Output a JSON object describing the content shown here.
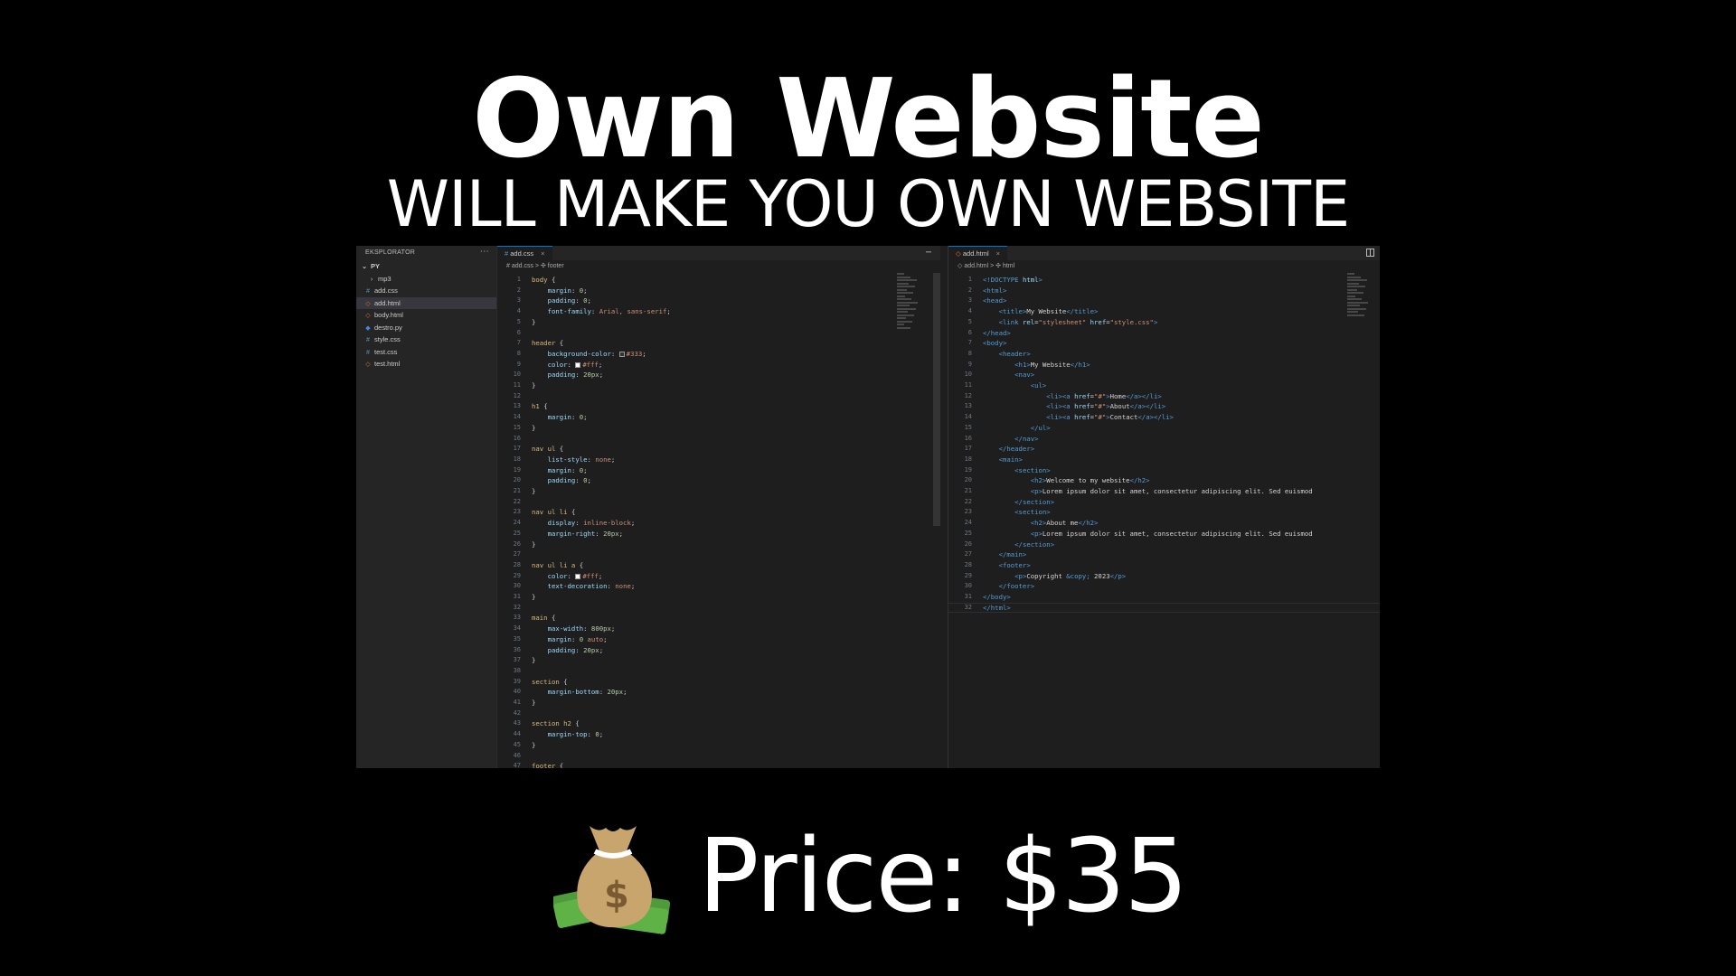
{
  "headline": "Own Website",
  "subline": "WILL MAKE YOU OWN WEBSITE",
  "price_label": "Price: $35",
  "editor": {
    "explorer_title": "EKSPLORATOR",
    "folder": "PY",
    "files": [
      {
        "name": "mp3",
        "kind": "folder"
      },
      {
        "name": "add.css",
        "kind": "css"
      },
      {
        "name": "add.html",
        "kind": "html",
        "active": true
      },
      {
        "name": "body.html",
        "kind": "html"
      },
      {
        "name": "destro.py",
        "kind": "py"
      },
      {
        "name": "style.css",
        "kind": "css"
      },
      {
        "name": "test.css",
        "kind": "css"
      },
      {
        "name": "test.html",
        "kind": "html"
      }
    ],
    "left_tab": "add.css",
    "left_crumb": "# add.css > ✣ footer",
    "right_tab": "add.html",
    "right_crumb": "◇ add.html > ✣ html",
    "css_lines": [
      [
        [
          "sel",
          "body "
        ],
        [
          "txt",
          "{"
        ]
      ],
      [
        [
          "prop",
          "    margin"
        ],
        [
          "txt",
          ": "
        ],
        [
          "num",
          "0"
        ],
        [
          "txt",
          ";"
        ]
      ],
      [
        [
          "prop",
          "    padding"
        ],
        [
          "txt",
          ": "
        ],
        [
          "num",
          "0"
        ],
        [
          "txt",
          ";"
        ]
      ],
      [
        [
          "prop",
          "    font-family"
        ],
        [
          "txt",
          ": "
        ],
        [
          "val",
          "Arial, sans-serif"
        ],
        [
          "txt",
          ";"
        ]
      ],
      [
        [
          "txt",
          "}"
        ]
      ],
      [],
      [
        [
          "sel",
          "header "
        ],
        [
          "txt",
          "{"
        ]
      ],
      [
        [
          "prop",
          "    background-color"
        ],
        [
          "txt",
          ": "
        ],
        [
          "sw",
          "#333"
        ],
        [
          "val",
          "#333"
        ],
        [
          "txt",
          ";"
        ]
      ],
      [
        [
          "prop",
          "    color"
        ],
        [
          "txt",
          ": "
        ],
        [
          "sw",
          "#fff"
        ],
        [
          "val",
          "#fff"
        ],
        [
          "txt",
          ";"
        ]
      ],
      [
        [
          "prop",
          "    padding"
        ],
        [
          "txt",
          ": "
        ],
        [
          "num",
          "20px"
        ],
        [
          "txt",
          ";"
        ]
      ],
      [
        [
          "txt",
          "}"
        ]
      ],
      [],
      [
        [
          "sel",
          "h1 "
        ],
        [
          "txt",
          "{"
        ]
      ],
      [
        [
          "prop",
          "    margin"
        ],
        [
          "txt",
          ": "
        ],
        [
          "num",
          "0"
        ],
        [
          "txt",
          ";"
        ]
      ],
      [
        [
          "txt",
          "}"
        ]
      ],
      [],
      [
        [
          "sel",
          "nav ul "
        ],
        [
          "txt",
          "{"
        ]
      ],
      [
        [
          "prop",
          "    list-style"
        ],
        [
          "txt",
          ": "
        ],
        [
          "val",
          "none"
        ],
        [
          "txt",
          ";"
        ]
      ],
      [
        [
          "prop",
          "    margin"
        ],
        [
          "txt",
          ": "
        ],
        [
          "num",
          "0"
        ],
        [
          "txt",
          ";"
        ]
      ],
      [
        [
          "prop",
          "    padding"
        ],
        [
          "txt",
          ": "
        ],
        [
          "num",
          "0"
        ],
        [
          "txt",
          ";"
        ]
      ],
      [
        [
          "txt",
          "}"
        ]
      ],
      [],
      [
        [
          "sel",
          "nav ul li "
        ],
        [
          "txt",
          "{"
        ]
      ],
      [
        [
          "prop",
          "    display"
        ],
        [
          "txt",
          ": "
        ],
        [
          "val",
          "inline-block"
        ],
        [
          "txt",
          ";"
        ]
      ],
      [
        [
          "prop",
          "    margin-right"
        ],
        [
          "txt",
          ": "
        ],
        [
          "num",
          "20px"
        ],
        [
          "txt",
          ";"
        ]
      ],
      [
        [
          "txt",
          "}"
        ]
      ],
      [],
      [
        [
          "sel",
          "nav ul li a "
        ],
        [
          "txt",
          "{"
        ]
      ],
      [
        [
          "prop",
          "    color"
        ],
        [
          "txt",
          ": "
        ],
        [
          "sw",
          "#fff"
        ],
        [
          "val",
          "#fff"
        ],
        [
          "txt",
          ";"
        ]
      ],
      [
        [
          "prop",
          "    text-decoration"
        ],
        [
          "txt",
          ": "
        ],
        [
          "val",
          "none"
        ],
        [
          "txt",
          ";"
        ]
      ],
      [
        [
          "txt",
          "}"
        ]
      ],
      [],
      [
        [
          "sel",
          "main "
        ],
        [
          "txt",
          "{"
        ]
      ],
      [
        [
          "prop",
          "    max-width"
        ],
        [
          "txt",
          ": "
        ],
        [
          "num",
          "800px"
        ],
        [
          "txt",
          ";"
        ]
      ],
      [
        [
          "prop",
          "    margin"
        ],
        [
          "txt",
          ": "
        ],
        [
          "num",
          "0 "
        ],
        [
          "val",
          "auto"
        ],
        [
          "txt",
          ";"
        ]
      ],
      [
        [
          "prop",
          "    padding"
        ],
        [
          "txt",
          ": "
        ],
        [
          "num",
          "20px"
        ],
        [
          "txt",
          ";"
        ]
      ],
      [
        [
          "txt",
          "}"
        ]
      ],
      [],
      [
        [
          "sel",
          "section "
        ],
        [
          "txt",
          "{"
        ]
      ],
      [
        [
          "prop",
          "    margin-bottom"
        ],
        [
          "txt",
          ": "
        ],
        [
          "num",
          "20px"
        ],
        [
          "txt",
          ";"
        ]
      ],
      [
        [
          "txt",
          "}"
        ]
      ],
      [],
      [
        [
          "sel",
          "section h2 "
        ],
        [
          "txt",
          "{"
        ]
      ],
      [
        [
          "prop",
          "    margin-top"
        ],
        [
          "txt",
          ": "
        ],
        [
          "num",
          "0"
        ],
        [
          "txt",
          ";"
        ]
      ],
      [
        [
          "txt",
          "}"
        ]
      ],
      [],
      [
        [
          "sel",
          "footer "
        ],
        [
          "txt",
          "{"
        ]
      ]
    ],
    "html_lines": [
      [
        [
          "tag",
          "<!DOCTYPE "
        ],
        [
          "attr",
          "html"
        ],
        [
          "tag",
          ">"
        ]
      ],
      [
        [
          "tag",
          "<html>"
        ]
      ],
      [
        [
          "tag",
          "<head>"
        ]
      ],
      [
        [
          "txt",
          "    "
        ],
        [
          "tag",
          "<title>"
        ],
        [
          "txt",
          "My Website"
        ],
        [
          "tag",
          "</title>"
        ]
      ],
      [
        [
          "txt",
          "    "
        ],
        [
          "tag",
          "<link "
        ],
        [
          "attr",
          "rel"
        ],
        [
          "txt",
          "="
        ],
        [
          "str",
          "\"stylesheet\""
        ],
        [
          "attr",
          " href"
        ],
        [
          "txt",
          "="
        ],
        [
          "str",
          "\"style.css\""
        ],
        [
          "tag",
          ">"
        ]
      ],
      [
        [
          "tag",
          "</head>"
        ]
      ],
      [
        [
          "tag",
          "<body>"
        ]
      ],
      [
        [
          "txt",
          "    "
        ],
        [
          "tag",
          "<header>"
        ]
      ],
      [
        [
          "txt",
          "        "
        ],
        [
          "tag",
          "<h1>"
        ],
        [
          "txt",
          "My Website"
        ],
        [
          "tag",
          "</h1>"
        ]
      ],
      [
        [
          "txt",
          "        "
        ],
        [
          "tag",
          "<nav>"
        ]
      ],
      [
        [
          "txt",
          "            "
        ],
        [
          "tag",
          "<ul>"
        ]
      ],
      [
        [
          "txt",
          "                "
        ],
        [
          "tag",
          "<li><a "
        ],
        [
          "attr",
          "href"
        ],
        [
          "txt",
          "="
        ],
        [
          "str",
          "\"#\""
        ],
        [
          "tag",
          ">"
        ],
        [
          "txt",
          "Home"
        ],
        [
          "tag",
          "</a></li>"
        ]
      ],
      [
        [
          "txt",
          "                "
        ],
        [
          "tag",
          "<li><a "
        ],
        [
          "attr",
          "href"
        ],
        [
          "txt",
          "="
        ],
        [
          "str",
          "\"#\""
        ],
        [
          "tag",
          ">"
        ],
        [
          "txt",
          "About"
        ],
        [
          "tag",
          "</a></li>"
        ]
      ],
      [
        [
          "txt",
          "                "
        ],
        [
          "tag",
          "<li><a "
        ],
        [
          "attr",
          "href"
        ],
        [
          "txt",
          "="
        ],
        [
          "str",
          "\"#\""
        ],
        [
          "tag",
          ">"
        ],
        [
          "txt",
          "Contact"
        ],
        [
          "tag",
          "</a></li>"
        ]
      ],
      [
        [
          "txt",
          "            "
        ],
        [
          "tag",
          "</ul>"
        ]
      ],
      [
        [
          "txt",
          "        "
        ],
        [
          "tag",
          "</nav>"
        ]
      ],
      [
        [
          "txt",
          "    "
        ],
        [
          "tag",
          "</header>"
        ]
      ],
      [
        [
          "txt",
          "    "
        ],
        [
          "tag",
          "<main>"
        ]
      ],
      [
        [
          "txt",
          "        "
        ],
        [
          "tag",
          "<section>"
        ]
      ],
      [
        [
          "txt",
          "            "
        ],
        [
          "tag",
          "<h2>"
        ],
        [
          "txt",
          "Welcome to my website"
        ],
        [
          "tag",
          "</h2>"
        ]
      ],
      [
        [
          "txt",
          "            "
        ],
        [
          "tag",
          "<p>"
        ],
        [
          "txt",
          "Lorem ipsum dolor sit amet, consectetur adipiscing elit. Sed euismod"
        ]
      ],
      [
        [
          "txt",
          "        "
        ],
        [
          "tag",
          "</section>"
        ]
      ],
      [
        [
          "txt",
          "        "
        ],
        [
          "tag",
          "<section>"
        ]
      ],
      [
        [
          "txt",
          "            "
        ],
        [
          "tag",
          "<h2>"
        ],
        [
          "txt",
          "About me"
        ],
        [
          "tag",
          "</h2>"
        ]
      ],
      [
        [
          "txt",
          "            "
        ],
        [
          "tag",
          "<p>"
        ],
        [
          "txt",
          "Lorem ipsum dolor sit amet, consectetur adipiscing elit. Sed euismod"
        ]
      ],
      [
        [
          "txt",
          "        "
        ],
        [
          "tag",
          "</section>"
        ]
      ],
      [
        [
          "txt",
          "    "
        ],
        [
          "tag",
          "</main>"
        ]
      ],
      [
        [
          "txt",
          "    "
        ],
        [
          "tag",
          "<footer>"
        ]
      ],
      [
        [
          "txt",
          "        "
        ],
        [
          "tag",
          "<p>"
        ],
        [
          "txt",
          "Copyright "
        ],
        [
          "ent",
          "&copy;"
        ],
        [
          "txt",
          " 2023"
        ],
        [
          "tag",
          "</p>"
        ]
      ],
      [
        [
          "txt",
          "    "
        ],
        [
          "tag",
          "</footer>"
        ]
      ],
      [
        [
          "tag",
          "</body>"
        ]
      ],
      [
        [
          "tag",
          "</html>"
        ]
      ]
    ]
  }
}
